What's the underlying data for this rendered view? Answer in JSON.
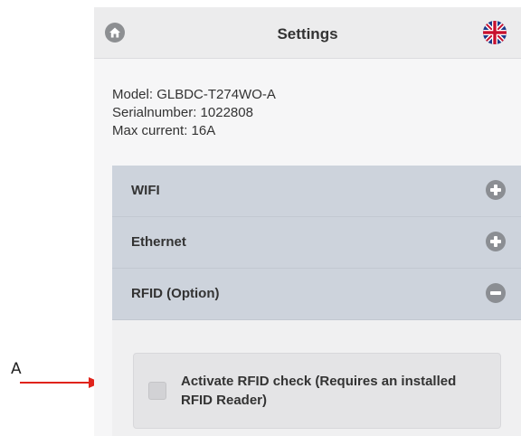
{
  "annotation": {
    "label": "A",
    "arrow_color": "#e0231b"
  },
  "header": {
    "title": "Settings",
    "home_icon": "home-icon",
    "language_icon": "uk-flag-icon"
  },
  "device_info": {
    "model": "Model: GLBDC-T274WO-A",
    "serial": "Serialnumber: 1022808",
    "max_current": "Max current: 16A"
  },
  "accordion": {
    "items": [
      {
        "label": "WIFI",
        "state": "collapsed",
        "icon": "plus-icon"
      },
      {
        "label": "Ethernet",
        "state": "collapsed",
        "icon": "plus-icon"
      },
      {
        "label": "RFID (Option)",
        "state": "expanded",
        "icon": "minus-icon"
      }
    ],
    "rfid": {
      "checkbox_label": "Activate RFID check (Requires an installed RFID Reader)",
      "checked": false
    }
  },
  "colors": {
    "accordion_header": "#cdd3dc",
    "icon_gray": "#8b8e93",
    "annotation_arrow": "#e0231b"
  }
}
